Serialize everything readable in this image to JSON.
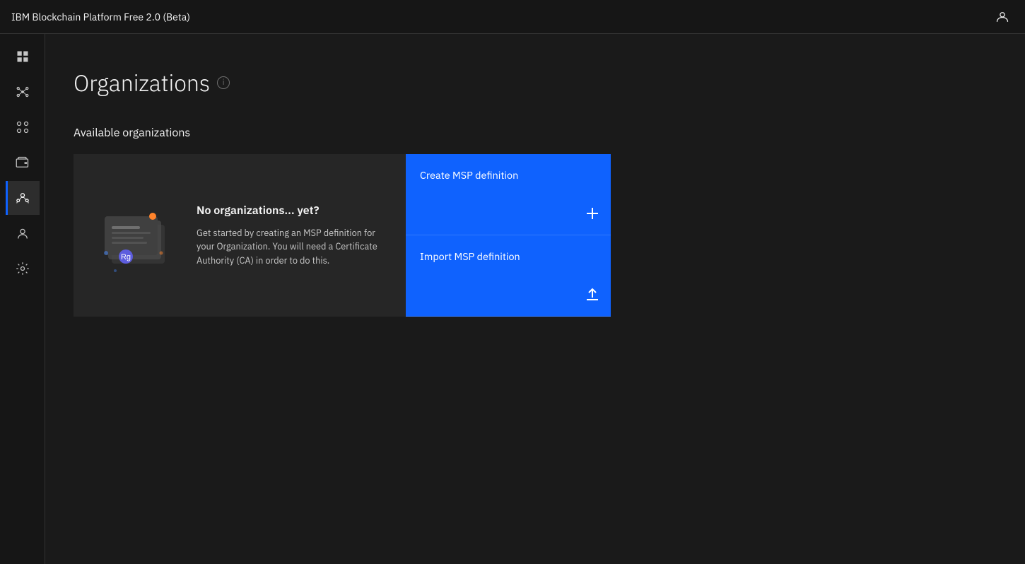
{
  "app": {
    "title": "IBM Blockchain Platform Free 2.0 (Beta)"
  },
  "sidebar": {
    "items": [
      {
        "id": "dashboard",
        "label": "Dashboard",
        "active": false
      },
      {
        "id": "network",
        "label": "Network",
        "active": false
      },
      {
        "id": "nodes",
        "label": "Nodes",
        "active": false
      },
      {
        "id": "wallet",
        "label": "Wallet",
        "active": false
      },
      {
        "id": "organizations",
        "label": "Organizations",
        "active": true
      },
      {
        "id": "identity",
        "label": "Identity",
        "active": false
      },
      {
        "id": "settings",
        "label": "Settings",
        "active": false
      }
    ]
  },
  "page": {
    "title": "Organizations",
    "section_title": "Available organizations"
  },
  "empty_state": {
    "title": "No organizations... yet?",
    "description": "Get started by creating an MSP definition for your Organization. You will need a Certificate Authority (CA) in order to do this."
  },
  "actions": [
    {
      "id": "create-msp",
      "label": "Create MSP definition",
      "icon": "plus"
    },
    {
      "id": "import-msp",
      "label": "Import MSP definition",
      "icon": "upload"
    }
  ]
}
